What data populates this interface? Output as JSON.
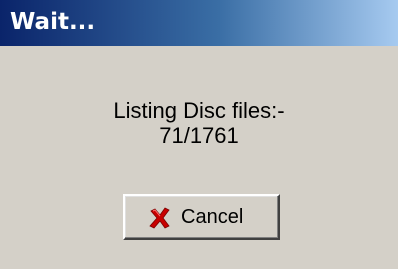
{
  "window": {
    "title": "Wait..."
  },
  "message": {
    "line1": "Listing Disc files:-",
    "line2": "71/1761"
  },
  "buttons": {
    "cancel_label": "Cancel",
    "cancel_icon": "red-x-icon"
  },
  "colors": {
    "dialog_background": "#d4d0c8",
    "titlebar_start": "#0a246a",
    "titlebar_end": "#a6caf0",
    "cancel_icon_color": "#c80000"
  }
}
